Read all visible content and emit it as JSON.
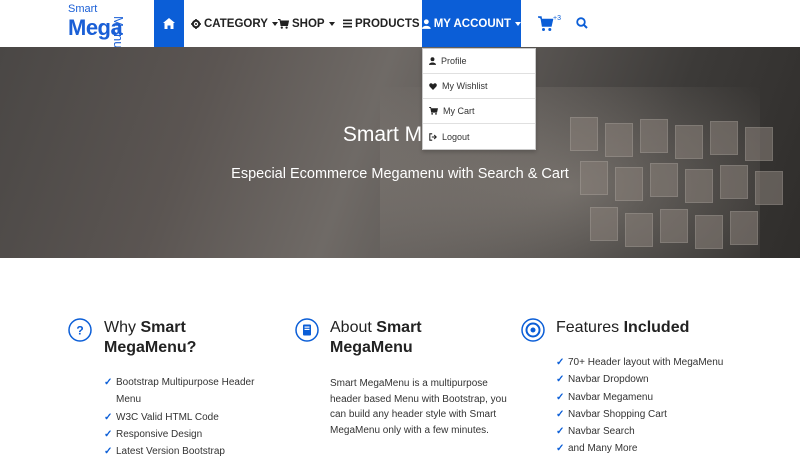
{
  "brand": {
    "line1": "Smart",
    "line2": "Mega",
    "line3": "Menu",
    "color": "#1a5fd6"
  },
  "nav": {
    "home_icon": "home-icon",
    "items": [
      {
        "label": "CATEGORY",
        "icon": "gear-icon"
      },
      {
        "label": "SHOP",
        "icon": "cart-icon"
      },
      {
        "label": "PRODUCTS",
        "icon": "list-icon"
      },
      {
        "label": "MY ACCOUNT",
        "icon": "user-icon"
      }
    ],
    "cart_badge": "3",
    "accent": "#0b5ed7"
  },
  "account_menu": {
    "items": [
      {
        "label": "Profile",
        "icon": "user-icon"
      },
      {
        "label": "My Wishlist",
        "icon": "heart-icon"
      },
      {
        "label": "My Cart",
        "icon": "cart-icon"
      },
      {
        "label": "Logout",
        "icon": "logout-icon"
      }
    ]
  },
  "hero": {
    "title": "Smart Mega",
    "subtitle": "Especial Ecommerce Megamenu with Search & Cart"
  },
  "features": [
    {
      "icon": "question-circle-icon",
      "title_plain": "Why ",
      "title_bold": "Smart",
      "title_line2": "MegaMenu?",
      "list": [
        "Bootstrap Multipurpose Header Menu",
        "W3C Valid HTML Code",
        "Responsive Design",
        "Latest Version Bootstrap"
      ]
    },
    {
      "icon": "book-icon",
      "title_plain": "About ",
      "title_bold": "Smart",
      "title_line2": "MegaMenu",
      "text": "Smart MegaMenu is a multipurpose header based Menu with Bootstrap, you can build any header style with Smart MegaMenu only with a few minutes."
    },
    {
      "icon": "target-icon",
      "title_plain": "Features ",
      "title_bold": "Included",
      "list": [
        "70+ Header layout with MegaMenu",
        "Navbar Dropdown",
        "Navbar Megamenu",
        "Navbar Shopping Cart",
        "Navbar Search",
        "and Many More"
      ]
    }
  ]
}
